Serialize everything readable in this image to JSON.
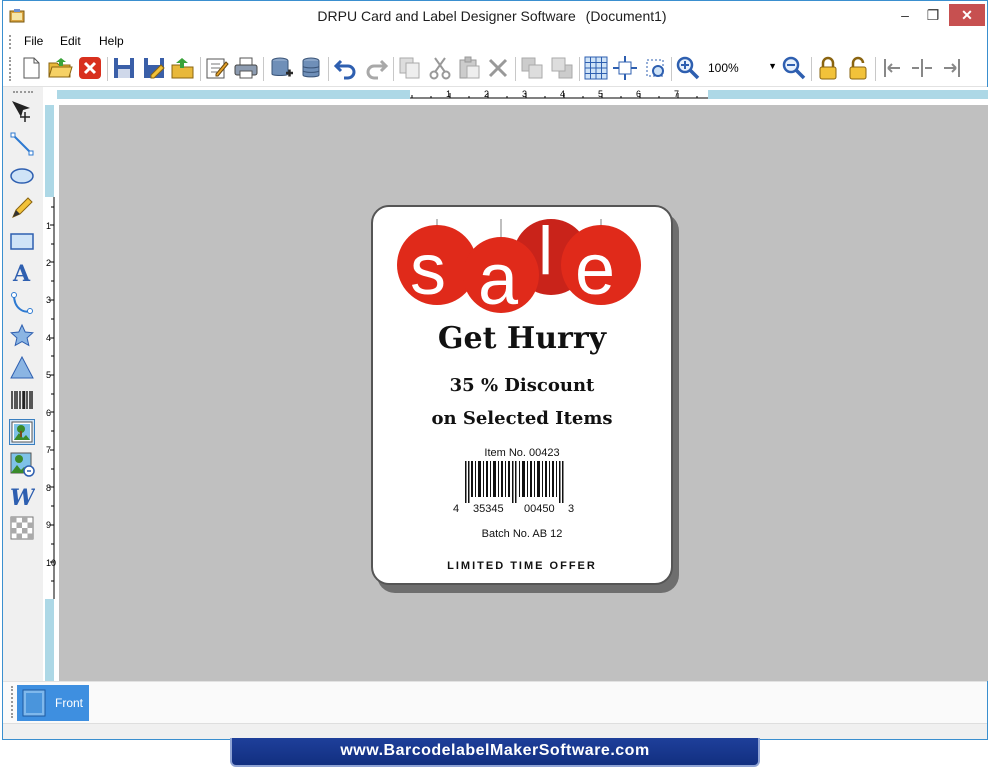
{
  "window": {
    "title": "DRPU Card and Label Designer Software",
    "document": "(Document1)",
    "minimize": "–",
    "maximize": "❐",
    "close": "✕"
  },
  "menu": {
    "items": [
      {
        "label": "File"
      },
      {
        "label": "Edit"
      },
      {
        "label": "Help"
      }
    ]
  },
  "toolbar": {
    "zoom_value": "100%",
    "buttons": [
      "new-icon",
      "open-icon",
      "close-doc-icon",
      "save-icon",
      "save-as-icon",
      "export-icon",
      "edit-icon",
      "print-icon",
      "database-add-icon",
      "database-icon",
      "undo-icon",
      "redo-icon",
      "copy-icon",
      "cut-icon",
      "paste-icon",
      "delete-icon",
      "bring-front-icon",
      "send-back-icon",
      "grid-icon",
      "center-icon",
      "fit-icon",
      "zoom-in-icon",
      "zoom-out-icon",
      "lock-icon",
      "unlock-icon",
      "align-left-icon",
      "align-center-icon",
      "align-right-icon"
    ]
  },
  "tools": [
    "select-icon",
    "line-icon",
    "ellipse-icon",
    "pencil-icon",
    "rectangle-icon",
    "text-icon",
    "curve-icon",
    "star-icon",
    "triangle-icon",
    "barcode-icon",
    "picture-icon",
    "image-library-icon",
    "wordart-icon",
    "background-icon"
  ],
  "ruler": {
    "h_marks": [
      "1",
      "2",
      "3",
      "4",
      "5",
      "6",
      "7"
    ],
    "v_marks": [
      "1",
      "2",
      "3",
      "4",
      "5",
      "6",
      "7",
      "8",
      "9",
      "10"
    ]
  },
  "label": {
    "sale_text": "sale",
    "headline": "Get Hurry",
    "discount": "35 % Discount",
    "selected": "on Selected Items",
    "item_no": "Item No. 00423",
    "barcode_digits": [
      "4",
      "35345",
      "00450",
      "3"
    ],
    "batch": "Batch No. AB 12",
    "offer": "LIMITED TIME OFFER",
    "sale_color": "#e02a1a"
  },
  "tabs": {
    "front": "Front"
  },
  "banner": {
    "url": "www.BarcodelabelMakerSoftware.com"
  }
}
